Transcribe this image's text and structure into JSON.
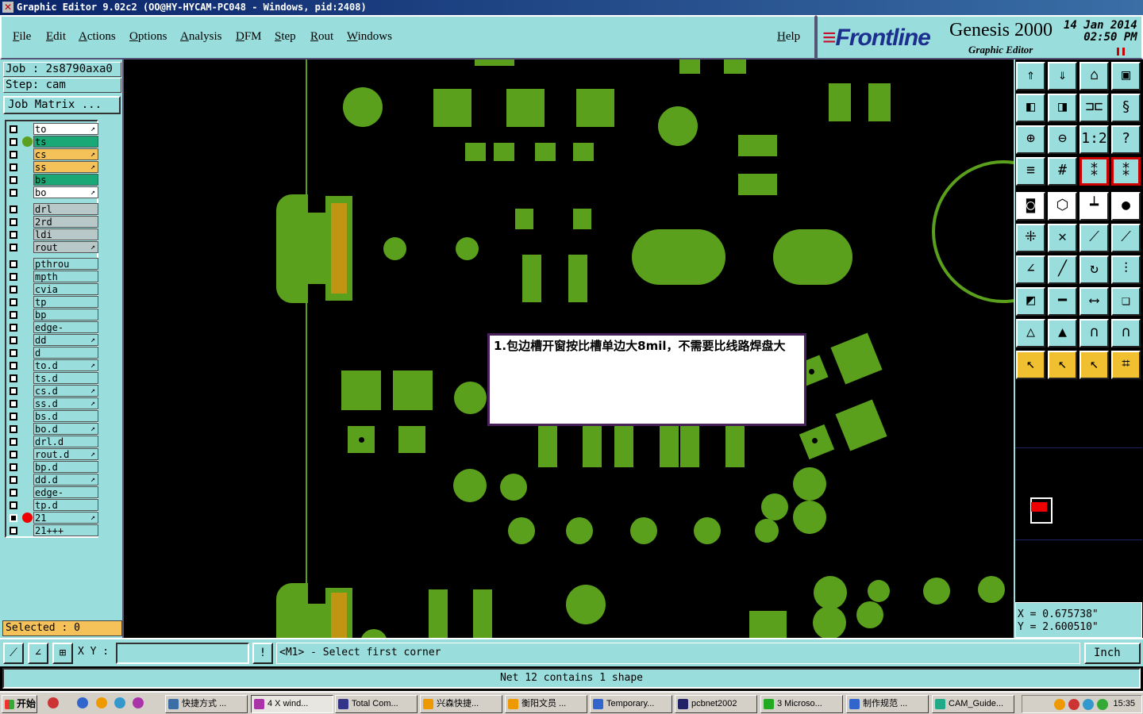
{
  "window": {
    "title": "Graphic Editor 9.02c2 (OO@HY-HYCAM-PC048 - Windows, pid:2408)"
  },
  "menu": [
    "File",
    "Edit",
    "Actions",
    "Options",
    "Analysis",
    "DFM",
    "Step",
    "Rout",
    "Windows"
  ],
  "help_label": "Help",
  "logo": {
    "brand_front": "Frontl",
    "brand_back": "ine",
    "product": "Genesis 2000",
    "subtitle": "Graphic Editor",
    "date": "14 Jan 2014",
    "time": "02:50 PM"
  },
  "job": {
    "job_label": "Job : 2s8790axa0",
    "step_label": "Step: cam",
    "matrix_button": "Job Matrix ..."
  },
  "layers": [
    {
      "name": "to",
      "color": "#ffffff",
      "arrow": true,
      "dot": ""
    },
    {
      "name": "ts",
      "color": "#1aa877",
      "arrow": false,
      "dot": "#5aa01c"
    },
    {
      "name": "cs",
      "color": "#f5c25a",
      "arrow": true,
      "dot": ""
    },
    {
      "name": "ss",
      "color": "#f5c25a",
      "arrow": true,
      "dot": ""
    },
    {
      "name": "bs",
      "color": "#1aa877",
      "arrow": false,
      "dot": ""
    },
    {
      "name": "bo",
      "color": "#ffffff",
      "arrow": true,
      "dot": ""
    },
    {
      "name": "drl",
      "color": "#b8c8c8",
      "arrow": false,
      "dot": "",
      "gap": true
    },
    {
      "name": "2rd",
      "color": "#b8c8c8",
      "arrow": false,
      "dot": ""
    },
    {
      "name": "ldi",
      "color": "#b8c8c8",
      "arrow": false,
      "dot": ""
    },
    {
      "name": "rout",
      "color": "#b8c8c8",
      "arrow": true,
      "dot": ""
    },
    {
      "name": "pthrou",
      "color": "#99dddd",
      "arrow": false,
      "dot": "",
      "gap": true
    },
    {
      "name": "mpth",
      "color": "#99dddd",
      "arrow": false,
      "dot": ""
    },
    {
      "name": "cvia",
      "color": "#99dddd",
      "arrow": false,
      "dot": ""
    },
    {
      "name": "tp",
      "color": "#99dddd",
      "arrow": false,
      "dot": ""
    },
    {
      "name": "bp",
      "color": "#99dddd",
      "arrow": false,
      "dot": ""
    },
    {
      "name": "edge-plated",
      "color": "#99dddd",
      "arrow": false,
      "dot": ""
    },
    {
      "name": "dd",
      "color": "#99dddd",
      "arrow": true,
      "dot": ""
    },
    {
      "name": "d",
      "color": "#99dddd",
      "arrow": false,
      "dot": ""
    },
    {
      "name": "to.d",
      "color": "#99dddd",
      "arrow": true,
      "dot": ""
    },
    {
      "name": "ts.d",
      "color": "#99dddd",
      "arrow": false,
      "dot": ""
    },
    {
      "name": "cs.d",
      "color": "#99dddd",
      "arrow": true,
      "dot": ""
    },
    {
      "name": "ss.d",
      "color": "#99dddd",
      "arrow": true,
      "dot": ""
    },
    {
      "name": "bs.d",
      "color": "#99dddd",
      "arrow": false,
      "dot": ""
    },
    {
      "name": "bo.d",
      "color": "#99dddd",
      "arrow": true,
      "dot": ""
    },
    {
      "name": "drl.d",
      "color": "#99dddd",
      "arrow": false,
      "dot": ""
    },
    {
      "name": "rout.d",
      "color": "#99dddd",
      "arrow": true,
      "dot": ""
    },
    {
      "name": "bp.d",
      "color": "#99dddd",
      "arrow": false,
      "dot": ""
    },
    {
      "name": "dd.d",
      "color": "#99dddd",
      "arrow": true,
      "dot": ""
    },
    {
      "name": "edge-plated",
      "color": "#99dddd",
      "arrow": false,
      "dot": ""
    },
    {
      "name": "tp.d",
      "color": "#99dddd",
      "arrow": false,
      "dot": ""
    },
    {
      "name": "21",
      "color": "#99dddd",
      "arrow": true,
      "dot": "#ee0000",
      "checked": true
    },
    {
      "name": "21+++",
      "color": "#99dddd",
      "arrow": false,
      "dot": ""
    }
  ],
  "selected_label": "Selected : 0",
  "popup_text": "1.包边槽开窗按比槽单边大8mil，不需要比线路焊盘大",
  "coords": {
    "x": "X = 0.675738\"",
    "y": "Y = 2.600510\""
  },
  "bottom": {
    "xy_label": "X Y :",
    "xy_value": "",
    "prompt": "<M1> - Select first corner",
    "unit": "Inch",
    "alert": "!"
  },
  "status": "Net 12 contains 1 shape",
  "taskbar": {
    "start": "开始",
    "tasks": [
      "快捷方式 ...",
      "4 X wind...",
      "Total Com...",
      "兴森快捷...",
      "衡阳文员 ...",
      "Temporary...",
      "pcbnet2002",
      "3 Microso...",
      "制作规范 ...",
      "CAM_Guide..."
    ],
    "clock": "15:35"
  },
  "colors": {
    "copper": "#5aa01c",
    "panel": "#99dddd",
    "gold": "#c09512",
    "highlight": "#ee0000"
  }
}
